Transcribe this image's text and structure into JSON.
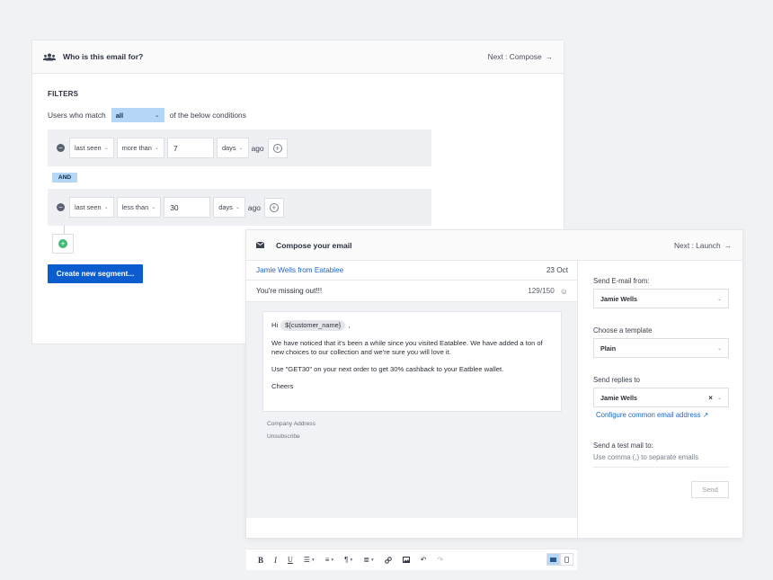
{
  "audience": {
    "title": "Who is this email for?",
    "next_label": "Next : Compose",
    "next_arrow": "→",
    "filters_label": "FILTERS",
    "match_prefix": "Users who match",
    "match_value": "all",
    "match_suffix": "of the below conditions",
    "conditions": [
      {
        "field": "last seen",
        "operator": "more than",
        "amount": "7",
        "unit": "days",
        "suffix": "ago"
      },
      {
        "field": "last seen",
        "operator": "less than",
        "amount": "30",
        "unit": "days",
        "suffix": "ago"
      }
    ],
    "join_label": "AND",
    "create_button": "Create new segment..."
  },
  "compose": {
    "title": "Compose your email",
    "next_label": "Next : Launch",
    "next_arrow": "→",
    "from": "Jamie Wells from Eatablee",
    "date": "23 Oct",
    "subject": "You're missing out!!!",
    "subject_count": "129/150",
    "body": {
      "greeting": "Hi",
      "token": "${customer_name}",
      "greeting_end": ",",
      "para1": "We have noticed that it's been a while since you visited Eatablee. We have added a ton of new choices to our collection and we're sure you will love it.",
      "para2": "Use \"GET30\" on your next order to get 30% cashback to your Eatblee wallet.",
      "signoff": "Cheers"
    },
    "company_address": "Company Address",
    "unsubscribe": "Unsubscribe",
    "settings": {
      "send_from_label": "Send E-mail from:",
      "send_from_value": "Jamie Wells",
      "template_label": "Choose a template",
      "template_value": "Plain",
      "reply_label": "Send replies to",
      "reply_value": "Jamie Wells",
      "configure_link": "Configure common email address",
      "test_label": "Send a test mail to:",
      "test_placeholder": "Use comma (,) to separate emails",
      "send_button": "Send"
    }
  }
}
